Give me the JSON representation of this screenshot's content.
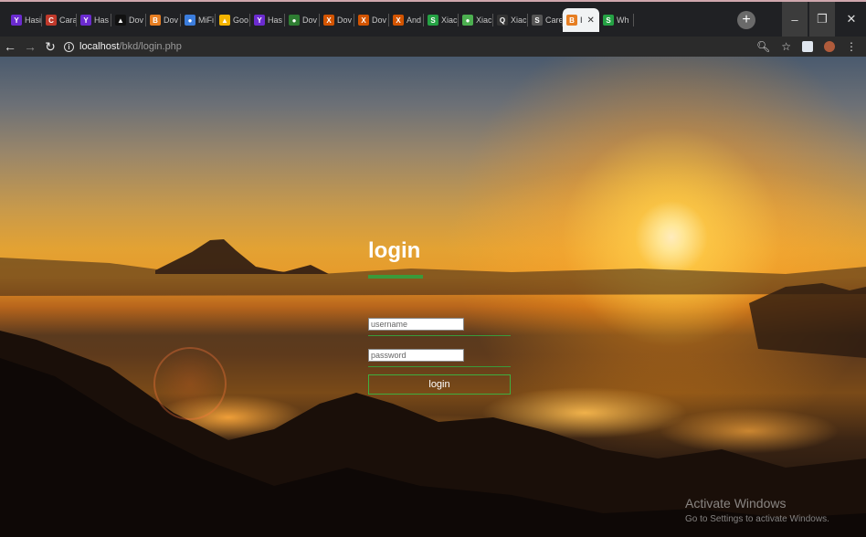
{
  "browser": {
    "tabs": [
      {
        "label": "Hasi",
        "icon": "yahoo-icon",
        "color": "#6b2bd0",
        "glyph": "Y"
      },
      {
        "label": "Cara",
        "icon": "carousell-icon",
        "color": "#c0392b",
        "glyph": "C"
      },
      {
        "label": "Has",
        "icon": "yahoo-icon",
        "color": "#6b2bd0",
        "glyph": "Y"
      },
      {
        "label": "Dov",
        "icon": "download-icon",
        "color": "#111111",
        "glyph": "▲"
      },
      {
        "label": "Dov",
        "icon": "download-icon",
        "color": "#e67e22",
        "glyph": "B"
      },
      {
        "label": "MiFi",
        "icon": "globe-icon",
        "color": "#3b7ddd",
        "glyph": "●"
      },
      {
        "label": "Goo",
        "icon": "google-drive-icon",
        "color": "#f4b400",
        "glyph": "▲"
      },
      {
        "label": "Has",
        "icon": "yahoo-icon",
        "color": "#6b2bd0",
        "glyph": "Y"
      },
      {
        "label": "Dov",
        "icon": "download-icon",
        "color": "#2e7d32",
        "glyph": "●"
      },
      {
        "label": "Dov",
        "icon": "x-icon",
        "color": "#d35400",
        "glyph": "X"
      },
      {
        "label": "Dov",
        "icon": "x-icon",
        "color": "#d35400",
        "glyph": "X"
      },
      {
        "label": "And",
        "icon": "x-icon",
        "color": "#d35400",
        "glyph": "X"
      },
      {
        "label": "Xiac",
        "icon": "whatsapp-icon",
        "color": "#25a244",
        "glyph": "S"
      },
      {
        "label": "Xiac",
        "icon": "leaf-icon",
        "color": "#4caf50",
        "glyph": "●"
      },
      {
        "label": "Xiac",
        "icon": "location-icon",
        "color": "#333333",
        "glyph": "Q"
      },
      {
        "label": "Care",
        "icon": "globe-icon",
        "color": "#555555",
        "glyph": "S"
      },
      {
        "label": "I",
        "icon": "website-icon",
        "color": "#e67e22",
        "glyph": "B",
        "active": true
      },
      {
        "label": "Wh",
        "icon": "whatsapp-icon",
        "color": "#25a244",
        "glyph": "S"
      }
    ],
    "url_host": "localhost",
    "url_path": "/bkd/login.php"
  },
  "login": {
    "title": "login",
    "username_placeholder": "username",
    "password_placeholder": "password",
    "button_label": "login",
    "accent": "#3a9a3a"
  },
  "watermark": {
    "line1": "Activate Windows",
    "line2": "Go to Settings to activate Windows."
  }
}
